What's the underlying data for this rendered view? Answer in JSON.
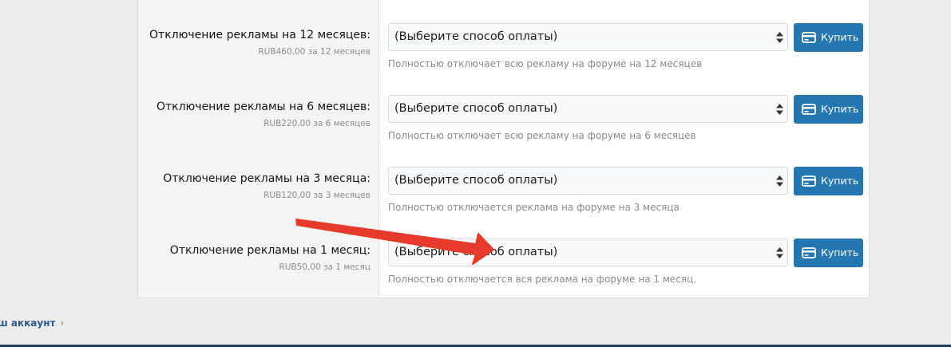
{
  "rows": [
    {
      "title": "Отключение рекламы на 12 месяцев:",
      "price": "RUB460,00 за 12 месяцев",
      "select_value": "(Выберите способ оплаты)",
      "button_label": "Купить",
      "description": "Полностью отключает всю рекламу на форуме на 12 месяцев"
    },
    {
      "title": "Отключение рекламы на 6 месяцев:",
      "price": "RUB220,00 за 6 месяцев",
      "select_value": "(Выберите способ оплаты)",
      "button_label": "Купить",
      "description": "Полностью отключает всю рекламу на форуме на 6 месяцев"
    },
    {
      "title": "Отключение рекламы на 3 месяца:",
      "price": "RUB120,00 за 3 месяцев",
      "select_value": "(Выберите способ оплаты)",
      "button_label": "Купить",
      "description": "Полностью отключается реклама на форуме на 3 месяца"
    },
    {
      "title": "Отключение рекламы на 1 месяц:",
      "price": "RUB50,00 за 1 месяц",
      "select_value": "(Выберите способ оплаты)",
      "button_label": "Купить",
      "description": "Полностью отключается вся реклама на форуме на 1 месяц."
    }
  ],
  "footer": {
    "account_link": "ш аккаунт",
    "chevron": "›"
  },
  "colors": {
    "button": "#2577b1",
    "annotation_arrow": "#e53a2c",
    "link": "#2a5a8c"
  },
  "icons": {
    "button_icon": "credit-card-icon",
    "select_icon": "select-arrows-icon",
    "footer_icon": "chevron-right-icon"
  }
}
